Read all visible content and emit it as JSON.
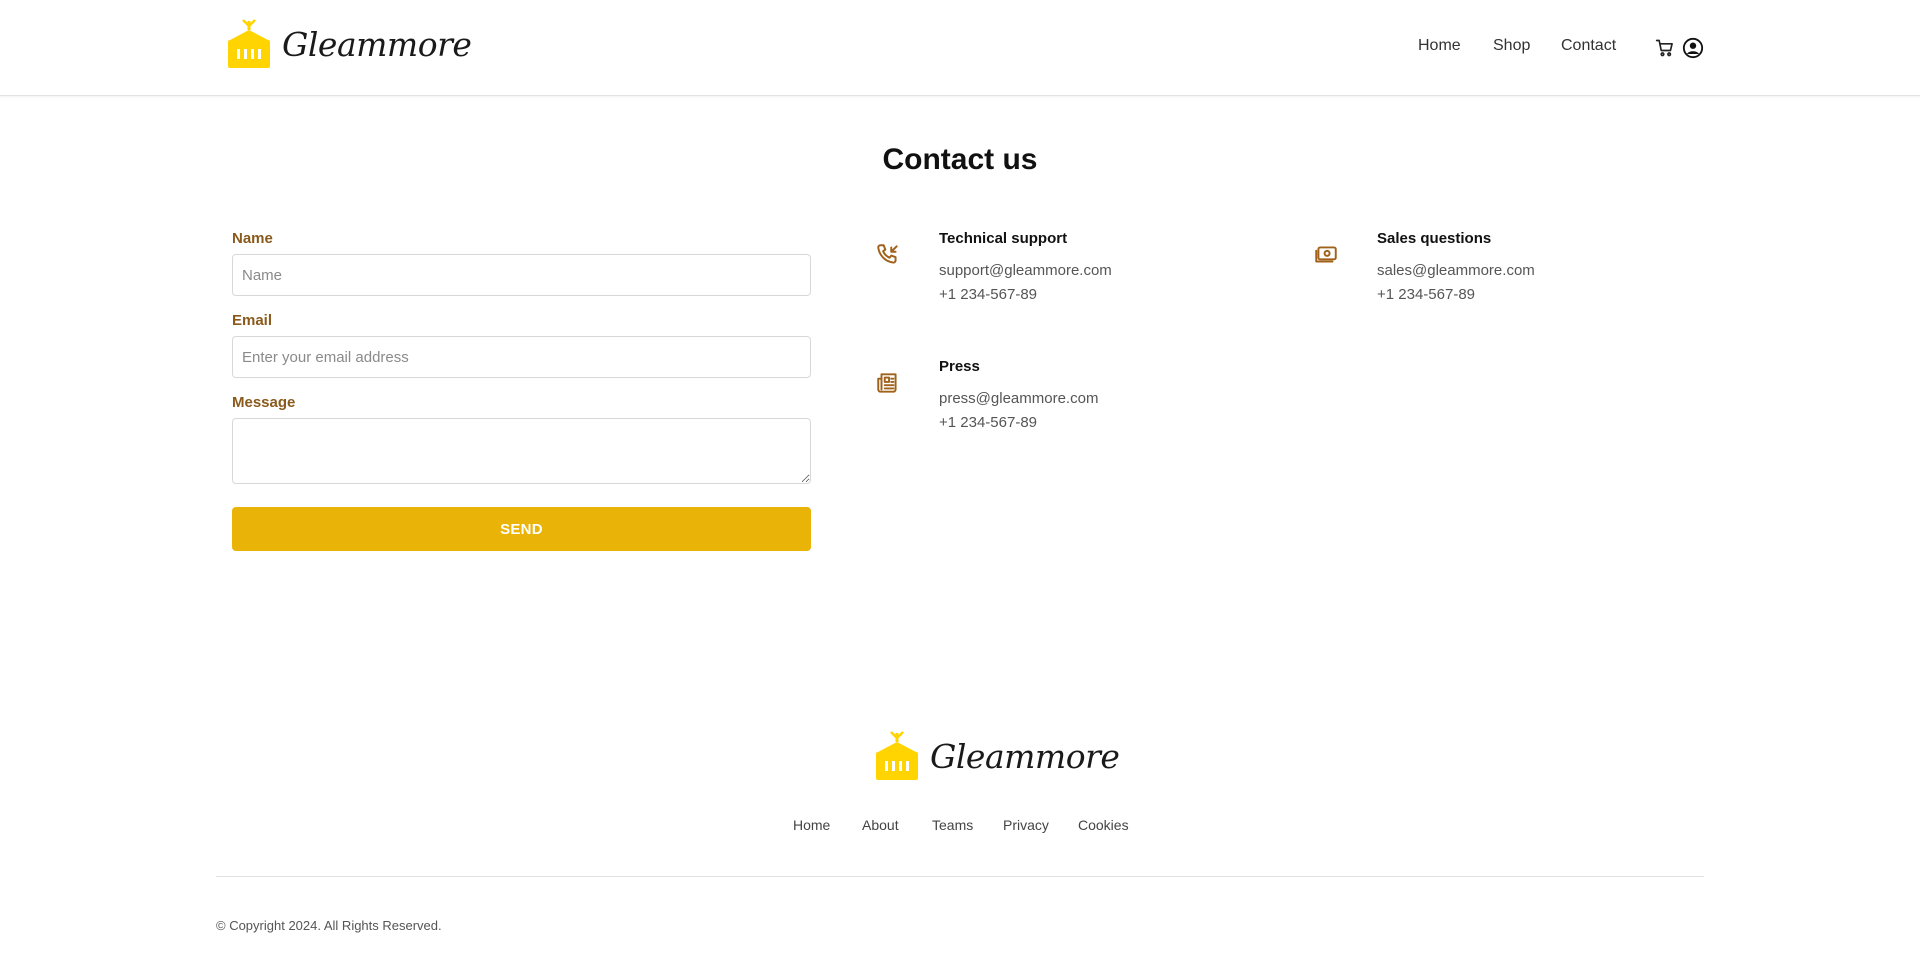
{
  "brand": {
    "name": "Gleammore",
    "logo_color": "#ffd400",
    "logo_icon": "container-crane-icon"
  },
  "nav": {
    "home": "Home",
    "shop": "Shop",
    "contact": "Contact",
    "cart_icon": "cart-icon",
    "account_icon": "user-circle-icon"
  },
  "page": {
    "title": "Contact us"
  },
  "form": {
    "name_label": "Name",
    "name_placeholder": "Name",
    "email_label": "Email",
    "email_placeholder": "Enter your email address",
    "message_label": "Message",
    "message_placeholder": "",
    "send_label": "SEND"
  },
  "contacts": [
    {
      "icon": "phone-incoming-icon",
      "title": "Technical support",
      "email": "support@gleammore.com",
      "phone": "+1 234-567-89"
    },
    {
      "icon": "money-icon",
      "title": "Sales questions",
      "email": "sales@gleammore.com",
      "phone": "+1 234-567-89"
    },
    {
      "icon": "newspaper-icon",
      "title": "Press",
      "email": "press@gleammore.com",
      "phone": "+1 234-567-89"
    }
  ],
  "footer": {
    "links": [
      "Home",
      "About",
      "Teams",
      "Privacy",
      "Cookies"
    ],
    "copyright": "© Copyright 2024. All Rights Reserved."
  },
  "colors": {
    "accent": "#eab308",
    "label": "#8a5a1c",
    "icon": "#a0621b"
  }
}
